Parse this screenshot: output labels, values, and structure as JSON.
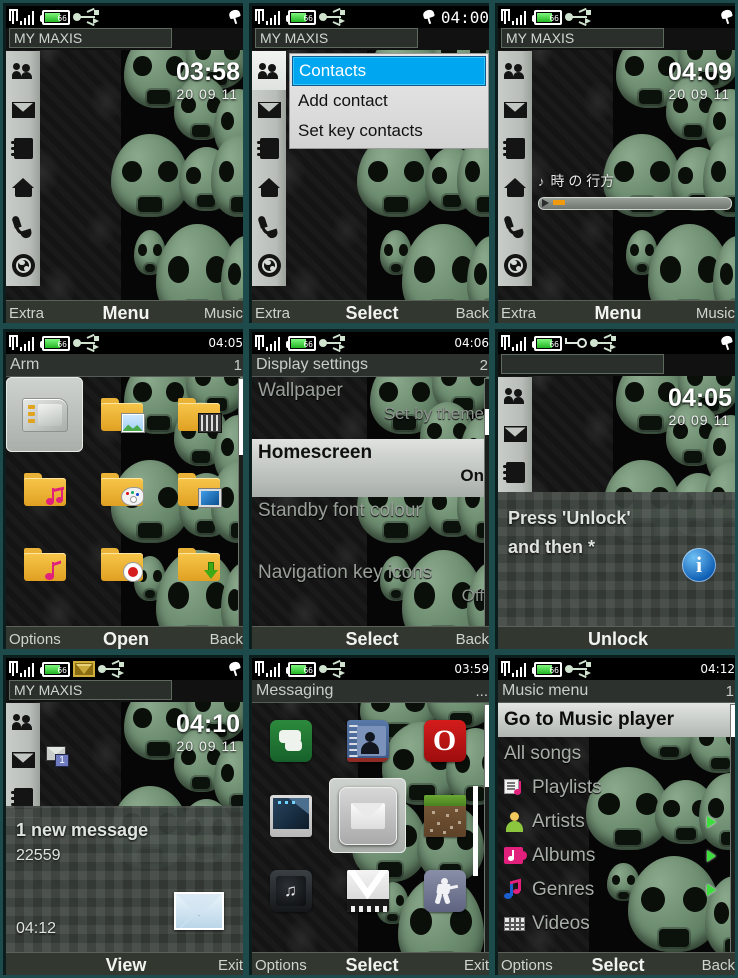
{
  "theme": {
    "border_color": "#1d4a4a",
    "accent_blue": "#00a6f0",
    "softkey_bg": "#32383a",
    "skull_green": "#6f8f72"
  },
  "status": {
    "battery_level": "66",
    "signal_icon": "signal-icon",
    "battery_icon": "battery-icon",
    "usb_icon": "usb-icon",
    "key_icon": "keypad-lock-icon",
    "envelope_icon": "envelope-status-icon",
    "bell_icon": "silent-bell-icon"
  },
  "rail_items": [
    {
      "name": "contacts",
      "icon": "contacts-icon"
    },
    {
      "name": "messaging",
      "icon": "envelope-icon"
    },
    {
      "name": "notes",
      "icon": "notebook-icon"
    },
    {
      "name": "homescreen",
      "icon": "home-icon"
    },
    {
      "name": "calls",
      "icon": "phone-handset-icon"
    },
    {
      "name": "web",
      "icon": "globe-icon"
    }
  ],
  "panels": [
    {
      "id": "home-idle",
      "operator": "MY MAXIS",
      "clock": "03:58",
      "date": "20 09 11",
      "softkeys": {
        "left": "Extra",
        "center": "Menu",
        "right": "Music"
      }
    },
    {
      "id": "contacts-popup",
      "operator": "MY MAXIS",
      "status_clock": "04:00",
      "menu": [
        {
          "label": "Contacts",
          "selected": true
        },
        {
          "label": "Add contact",
          "selected": false
        },
        {
          "label": "Set key contacts",
          "selected": false
        }
      ],
      "softkeys": {
        "left": "Extra",
        "center": "Select",
        "right": "Back"
      }
    },
    {
      "id": "home-music",
      "operator": "MY MAXIS",
      "clock": "04:09",
      "date": "20 09 11",
      "track": "時 の 行方",
      "note_icon": "music-note-icon",
      "play_icon": "play-icon",
      "progress_percent": 6,
      "softkeys": {
        "left": "Extra",
        "center": "Menu",
        "right": "Music"
      }
    },
    {
      "id": "arm-folder",
      "status_clock": "04:05",
      "title": "Arm",
      "title_right": "1",
      "icons": [
        {
          "name": "memory-card-icon",
          "selected": true
        },
        {
          "name": "folder-images-icon",
          "selected": false
        },
        {
          "name": "folder-videos-icon",
          "selected": false
        },
        {
          "name": "folder-music-pink-icon",
          "selected": false
        },
        {
          "name": "folder-graphics-icon",
          "selected": false
        },
        {
          "name": "folder-display-icon",
          "selected": false
        },
        {
          "name": "folder-tones-icon",
          "selected": false
        },
        {
          "name": "folder-recordings-icon",
          "selected": false
        },
        {
          "name": "folder-downloads-icon",
          "selected": false
        }
      ],
      "softkeys": {
        "left": "Options",
        "center": "Open",
        "right": "Back"
      }
    },
    {
      "id": "display-settings",
      "status_clock": "04:06",
      "title": "Display settings",
      "title_right": "2",
      "rows": [
        {
          "label": "Wallpaper",
          "value": "Set by theme",
          "selected": false
        },
        {
          "label": "Homescreen",
          "value": "On",
          "selected": true
        },
        {
          "label": "Standby font colour",
          "value": "",
          "selected": false
        },
        {
          "label": "Navigation key icons",
          "value": "Off",
          "selected": false
        }
      ],
      "softkeys": {
        "left": "",
        "center": "Select",
        "right": "Back"
      }
    },
    {
      "id": "keylock",
      "operator": "",
      "clock": "04:05",
      "date": "20 09 11",
      "message_line1": "Press 'Unlock'",
      "message_line2": "and then *",
      "info_icon": "info-icon",
      "softkeys": {
        "left": "",
        "center": "Unlock",
        "right": ""
      }
    },
    {
      "id": "new-message",
      "operator": "MY MAXIS",
      "clock": "04:10",
      "date": "20 09 11",
      "badge_count": "1",
      "message_title": "1 new message",
      "sender": "22559",
      "received_time": "04:12",
      "envelope_icon": "envelope-large-icon",
      "softkeys": {
        "left": "",
        "center": "View",
        "right": "Exit"
      }
    },
    {
      "id": "messaging-grid",
      "status_clock": "03:59",
      "title": "Messaging",
      "title_right": "...",
      "icons": [
        {
          "name": "messages-app-icon",
          "selected": false
        },
        {
          "name": "contacts-book-app-icon",
          "selected": false
        },
        {
          "name": "opera-browser-icon",
          "selected": false
        },
        {
          "name": "gallery-app-icon",
          "selected": false
        },
        {
          "name": "mail-app-icon",
          "selected": true
        },
        {
          "name": "minecraft-app-icon",
          "selected": false
        },
        {
          "name": "music-player-app-icon",
          "selected": false
        },
        {
          "name": "mflag-app-icon",
          "selected": false
        },
        {
          "name": "counter-strike-app-icon",
          "selected": false
        }
      ],
      "softkeys": {
        "left": "Options",
        "center": "Select",
        "right": "Exit"
      }
    },
    {
      "id": "music-menu",
      "status_clock": "04:12",
      "title": "Music menu",
      "title_right": "1",
      "rows": [
        {
          "label": "Go to Music player",
          "icon": "",
          "selected": true,
          "arrow": false
        },
        {
          "label": "All songs",
          "icon": "",
          "selected": false,
          "arrow": false
        },
        {
          "label": "Playlists",
          "icon": "playlist-icon",
          "selected": false,
          "arrow": false
        },
        {
          "label": "Artists",
          "icon": "artist-icon",
          "selected": false,
          "arrow": true
        },
        {
          "label": "Albums",
          "icon": "album-icon",
          "selected": false,
          "arrow": true
        },
        {
          "label": "Genres",
          "icon": "genre-icon",
          "selected": false,
          "arrow": true
        },
        {
          "label": "Videos",
          "icon": "video-icon",
          "selected": false,
          "arrow": false
        }
      ],
      "softkeys": {
        "left": "Options",
        "center": "Select",
        "right": "Back"
      }
    }
  ]
}
